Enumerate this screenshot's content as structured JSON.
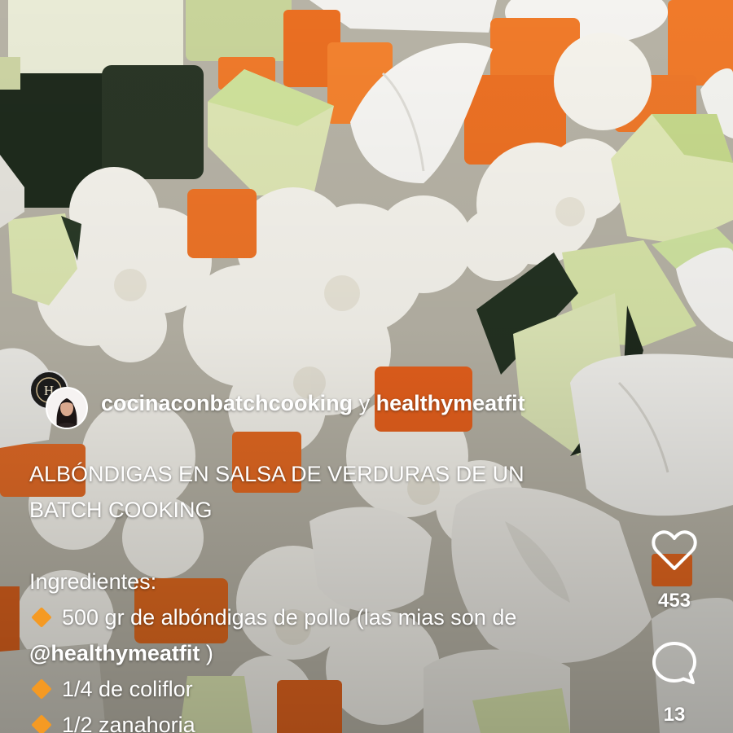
{
  "post": {
    "author_1": "cocinaconbatchcooking",
    "joiner": "y",
    "author_2": "healthymeatfit",
    "title_line_1": "ALBÓNDIGAS EN SALSA DE VERDURAS DE UN",
    "title_line_2": "BATCH COOKING",
    "ingredients_heading": "Ingredientes:",
    "ingredients": [
      {
        "text_a": "500 gr de albóndigas de pollo (las mias son de",
        "mention": "@healthymeatfit",
        "text_b": " )"
      },
      {
        "text": "1/4 de coliflor"
      },
      {
        "text": "1/2 zanahoria"
      }
    ]
  },
  "actions": {
    "like_count": "453",
    "comment_count": "13",
    "like_icon": "heart-outline-icon",
    "comment_icon": "speech-bubble-icon"
  },
  "avatar_1_monogram": "H",
  "colors": {
    "bullet": "#f59a23",
    "text": "#ffffff"
  }
}
